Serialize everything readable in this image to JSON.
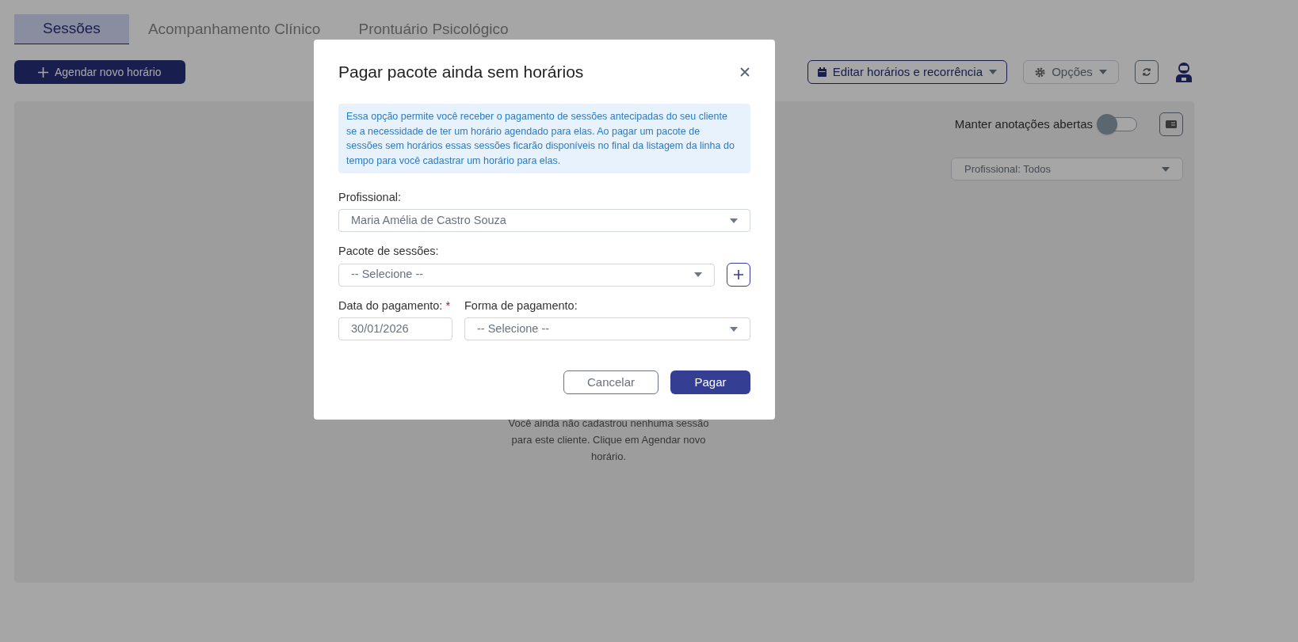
{
  "tabs": [
    {
      "label": "Sessões",
      "selected": true
    },
    {
      "label": "Acompanhamento Clínico",
      "selected": false
    },
    {
      "label": "Prontuário Psicológico",
      "selected": false
    }
  ],
  "schedule_button": "Agendar novo horário",
  "edit_button": "Editar horários e recorrência",
  "options_button": "Opções",
  "notes_toggle": {
    "label": "Manter anotações abertas",
    "on": false
  },
  "professional_filter": "Profissional: Todos",
  "empty_state": "Você ainda não cadastrou nenhuma sessão para este cliente. Clique em Agendar novo horário.",
  "modal": {
    "title": "Pagar pacote ainda sem horários",
    "info": "Essa opção permite você receber o pagamento de sessões antecipadas do seu cliente se a necessidade de ter um horário agendado para elas. Ao pagar um pacote de sessões sem horários essas sessões ficarão disponíveis no final da listagem da linha do tempo para você cadastrar um horário para elas.",
    "rows": [
      [
        {
          "kind": "select",
          "label": "Profissional:",
          "value": "Maria Amélia de Castro Souza"
        }
      ],
      [
        {
          "kind": "select",
          "label": "Pacote de sessões:",
          "placeholder": "-- Selecione --",
          "add_button": true
        }
      ],
      [
        {
          "kind": "date",
          "label": "Data do pagamento:",
          "value": "30/01/2026",
          "required_mark": "*"
        },
        {
          "kind": "select",
          "label": "Forma de pagamento:",
          "placeholder": "-- Selecione --"
        }
      ]
    ],
    "cancel_button": "Cancelar",
    "pay_button": "Pagar"
  }
}
